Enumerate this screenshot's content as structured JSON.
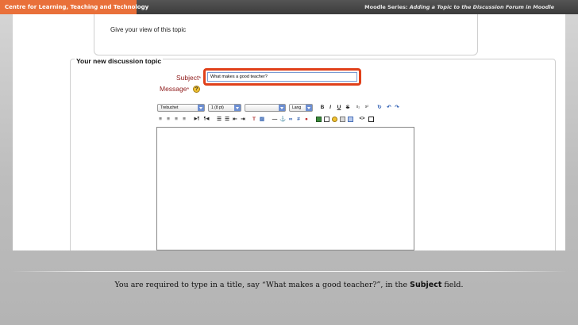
{
  "header": {
    "org": "Centre for Learning, Teaching and Technology",
    "series_prefix": "Moodle Series:",
    "series_title": "Adding a Topic to the Discussion Forum in Moodle"
  },
  "form": {
    "view_text": "Give your view of this topic",
    "section_title": "Your new discussion topic",
    "subject_label": "Subject",
    "subject_required": "*",
    "subject_value": "What makes a good teacher?",
    "message_label": "Message",
    "message_required": "*",
    "help_icon_text": "?"
  },
  "toolbar": {
    "font_family": "Trebuchet",
    "font_size": "1 (8 pt)",
    "heading": "",
    "lang": "Lang",
    "bold": "B",
    "italic": "I",
    "underline": "U",
    "strike": "S",
    "sub": "x₂",
    "sup": "x²",
    "undo_icon": "undo-icon",
    "redo_icon": "redo-icon"
  },
  "caption": {
    "before": "You are required to type in a title, say “What makes a good teacher?”, in the ",
    "bold": "Subject",
    "after": " field."
  },
  "colors": {
    "accent_orange": "#e9703a",
    "highlight_red": "#e0401a",
    "label_red": "#8e1a1a"
  }
}
